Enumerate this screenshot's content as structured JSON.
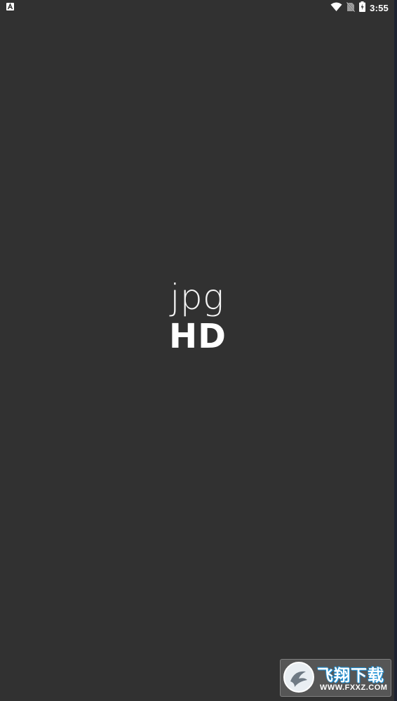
{
  "status_bar": {
    "time": "3:55",
    "icons": [
      "notification-a-icon",
      "wifi-icon",
      "no-sim-icon",
      "battery-charging-icon"
    ]
  },
  "splash": {
    "line1": "jpg",
    "line2": "HD"
  },
  "watermark": {
    "text": "飞翔下载",
    "url": "WWW.FXXZ.COM"
  },
  "colors": {
    "background": "#313131",
    "text": "#ffffff",
    "watermark_accent": "#1a8fd6"
  }
}
